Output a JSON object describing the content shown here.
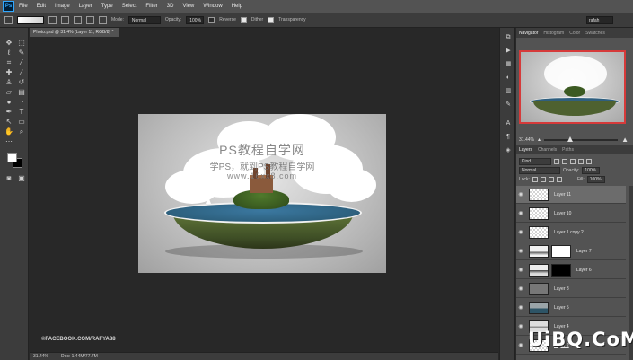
{
  "app": {
    "logo": "Ps"
  },
  "menu": [
    "File",
    "Edit",
    "Image",
    "Layer",
    "Type",
    "Select",
    "Filter",
    "3D",
    "View",
    "Window",
    "Help"
  ],
  "options": {
    "mode_label": "Mode:",
    "mode_value": "Normal",
    "opacity_label": "Opacity:",
    "opacity_value": "100%",
    "reverse_label": "Reverse",
    "dither_label": "Dither",
    "transparency_label": "Transparency",
    "workspace_value": "rafah"
  },
  "document": {
    "tab_title": "Photo.psd @ 31.4% (Layer 11, RGB/8) *",
    "zoom": "31.44%",
    "doc_size": "Doc: 1.44M/77.7M",
    "watermark_title": "PS教程自学网",
    "watermark_sub": "学PS，就到PS教程自学网",
    "watermark_url": "www.16xx8.com",
    "credit": "©FACEBOOK.COM/RAFYA88"
  },
  "navigator": {
    "tabs": [
      "Navigator",
      "Histogram",
      "Color",
      "Swatches"
    ],
    "zoom": "31.44%",
    "zoom_level": 0.3144
  },
  "layers_panel": {
    "tabs": [
      "Layers",
      "Channels",
      "Paths"
    ],
    "filter_kind": "Kind",
    "blend_mode": "Normal",
    "opacity_label": "Opacity:",
    "opacity_value": "100%",
    "lock_label": "Lock:",
    "fill_label": "Fill:",
    "fill_value": "100%",
    "layers": [
      {
        "name": "Layer 11"
      },
      {
        "name": "Layer 10"
      },
      {
        "name": "Layer 1 copy 2"
      },
      {
        "name": "Layer 7"
      },
      {
        "name": "Layer 6"
      },
      {
        "name": "Layer 8"
      },
      {
        "name": "Layer 5"
      },
      {
        "name": "Layer 4"
      },
      {
        "name": "Layer 2"
      }
    ]
  },
  "site_watermark": "UiBQ.CoM",
  "colors": {
    "accent_red": "#d63a3a",
    "panel": "#535353",
    "chrome": "#3c3c3c",
    "workspace": "#282828"
  }
}
